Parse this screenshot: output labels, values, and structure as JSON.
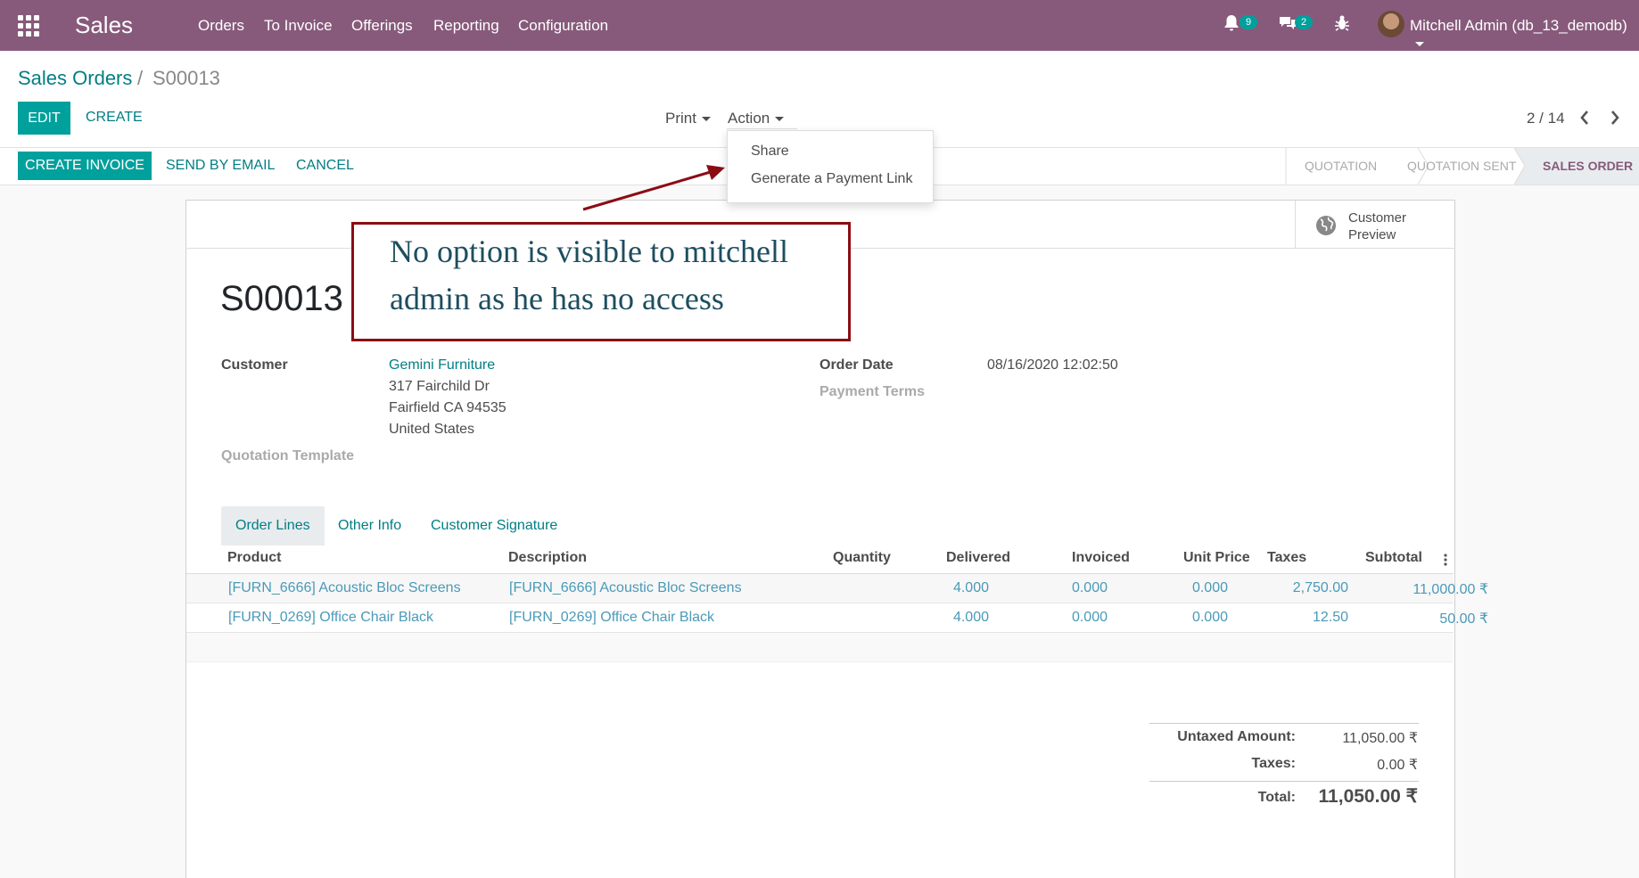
{
  "topbar": {
    "app_name": "Sales",
    "menu": [
      "Orders",
      "To Invoice",
      "Offerings",
      "Reporting",
      "Configuration"
    ],
    "notifications_count": "9",
    "messages_count": "2",
    "user": "Mitchell Admin (db_13_demodb)"
  },
  "breadcrumb": {
    "parent": "Sales Orders",
    "separator": "/",
    "current": "S00013"
  },
  "buttons": {
    "edit": "Edit",
    "create": "Create",
    "print": "Print",
    "action": "Action"
  },
  "pager": {
    "text": "2 / 14"
  },
  "status_bar": {
    "create_invoice": "Create Invoice",
    "send_by_email": "Send by Email",
    "cancel": "Cancel",
    "stages": [
      "Quotation",
      "Quotation Sent",
      "Sales Order"
    ],
    "active_stage": "Sales Order"
  },
  "action_menu": {
    "items": [
      "Share",
      "Generate a Payment Link"
    ]
  },
  "preview": {
    "line1": "Customer",
    "line2": "Preview"
  },
  "form": {
    "title": "S00013",
    "customer_label": "Customer",
    "customer_name": "Gemini Furniture",
    "address_line1": "317 Fairchild Dr",
    "address_line2": "Fairfield CA 94535",
    "address_line3": "United States",
    "quotation_template_label": "Quotation Template",
    "order_date_label": "Order Date",
    "order_date": "08/16/2020 12:02:50",
    "payment_terms_label": "Payment Terms"
  },
  "tabs": [
    "Order Lines",
    "Other Info",
    "Customer Signature"
  ],
  "lines": {
    "headers": [
      "Product",
      "Description",
      "Quantity",
      "Delivered",
      "Invoiced",
      "Unit Price",
      "Taxes",
      "Subtotal"
    ],
    "rows": [
      {
        "product": "[FURN_6666] Acoustic Bloc Screens",
        "description": "[FURN_6666] Acoustic Bloc Screens",
        "quantity": "4.000",
        "delivered": "0.000",
        "invoiced": "0.000",
        "unit_price": "2,750.00",
        "taxes": "",
        "subtotal": "11,000.00 ₹"
      },
      {
        "product": "[FURN_0269] Office Chair Black",
        "description": "[FURN_0269] Office Chair Black",
        "quantity": "4.000",
        "delivered": "0.000",
        "invoiced": "0.000",
        "unit_price": "12.50",
        "taxes": "",
        "subtotal": "50.00 ₹"
      }
    ]
  },
  "totals": {
    "untaxed_label": "Untaxed Amount:",
    "untaxed_value": "11,050.00 ₹",
    "taxes_label": "Taxes:",
    "taxes_value": "0.00 ₹",
    "total_label": "Total:",
    "total_value": "11,050.00 ₹"
  },
  "annotation": {
    "text": "No option is visible to mitchell admin as he has no access"
  },
  "colors": {
    "brand": "#875a7b",
    "primary": "#00a09d",
    "link": "#017e84",
    "annotation": "#8b0d14"
  }
}
